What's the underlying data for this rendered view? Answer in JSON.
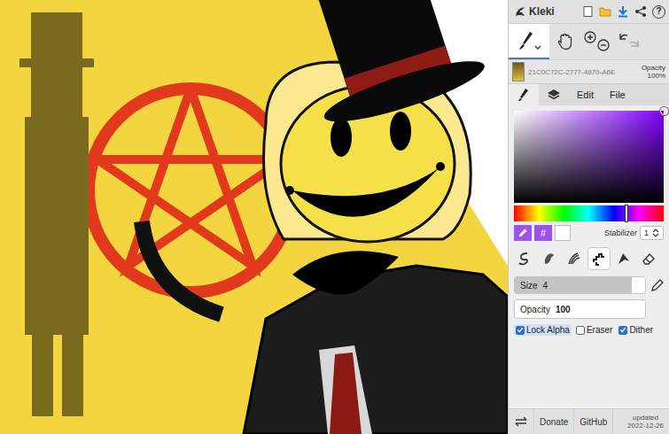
{
  "topbar": {
    "logo": "Kleki",
    "help": "?"
  },
  "tools": [
    {
      "kind": "brush",
      "selected": true
    },
    {
      "kind": "hand",
      "selected": false
    },
    {
      "kind": "zoom",
      "selected": false
    },
    {
      "kind": "history",
      "selected": false
    }
  ],
  "layer": {
    "name": "21C0C72C-2777-4870-A6E",
    "opacity_label": "Opacity",
    "opacity_value": "100%"
  },
  "tabs": [
    {
      "kind": "brush",
      "label": "",
      "selected": true
    },
    {
      "kind": "layers",
      "label": "",
      "selected": false
    },
    {
      "kind": "text",
      "label": "Edit",
      "selected": false
    },
    {
      "kind": "text",
      "label": "File",
      "selected": false
    }
  ],
  "picker": {
    "hue_level": 0.75,
    "saturation": 1,
    "brightness": 1,
    "hex_button": "#"
  },
  "stabilizer": {
    "label": "Stabilizer",
    "value": "1"
  },
  "brushes": [
    {
      "kind": "pen",
      "selected": false
    },
    {
      "kind": "blend",
      "selected": false
    },
    {
      "kind": "sketch",
      "selected": false
    },
    {
      "kind": "pixel",
      "selected": true
    },
    {
      "kind": "chemy",
      "selected": false
    },
    {
      "kind": "eraser",
      "selected": false
    }
  ],
  "size": {
    "label": "Size",
    "value": "4",
    "level": 0.9
  },
  "opacity": {
    "label": "Opacity",
    "value": "100"
  },
  "options": [
    {
      "label": "Lock Alpha",
      "checked": true,
      "focused": true
    },
    {
      "label": "Eraser",
      "checked": false,
      "focused": false
    },
    {
      "label": "Dither",
      "checked": true,
      "focused": false
    }
  ],
  "footer": {
    "links": [
      "Donate",
      "GitHub"
    ],
    "updated_label": "updated",
    "updated_date": "2022-12-26"
  }
}
